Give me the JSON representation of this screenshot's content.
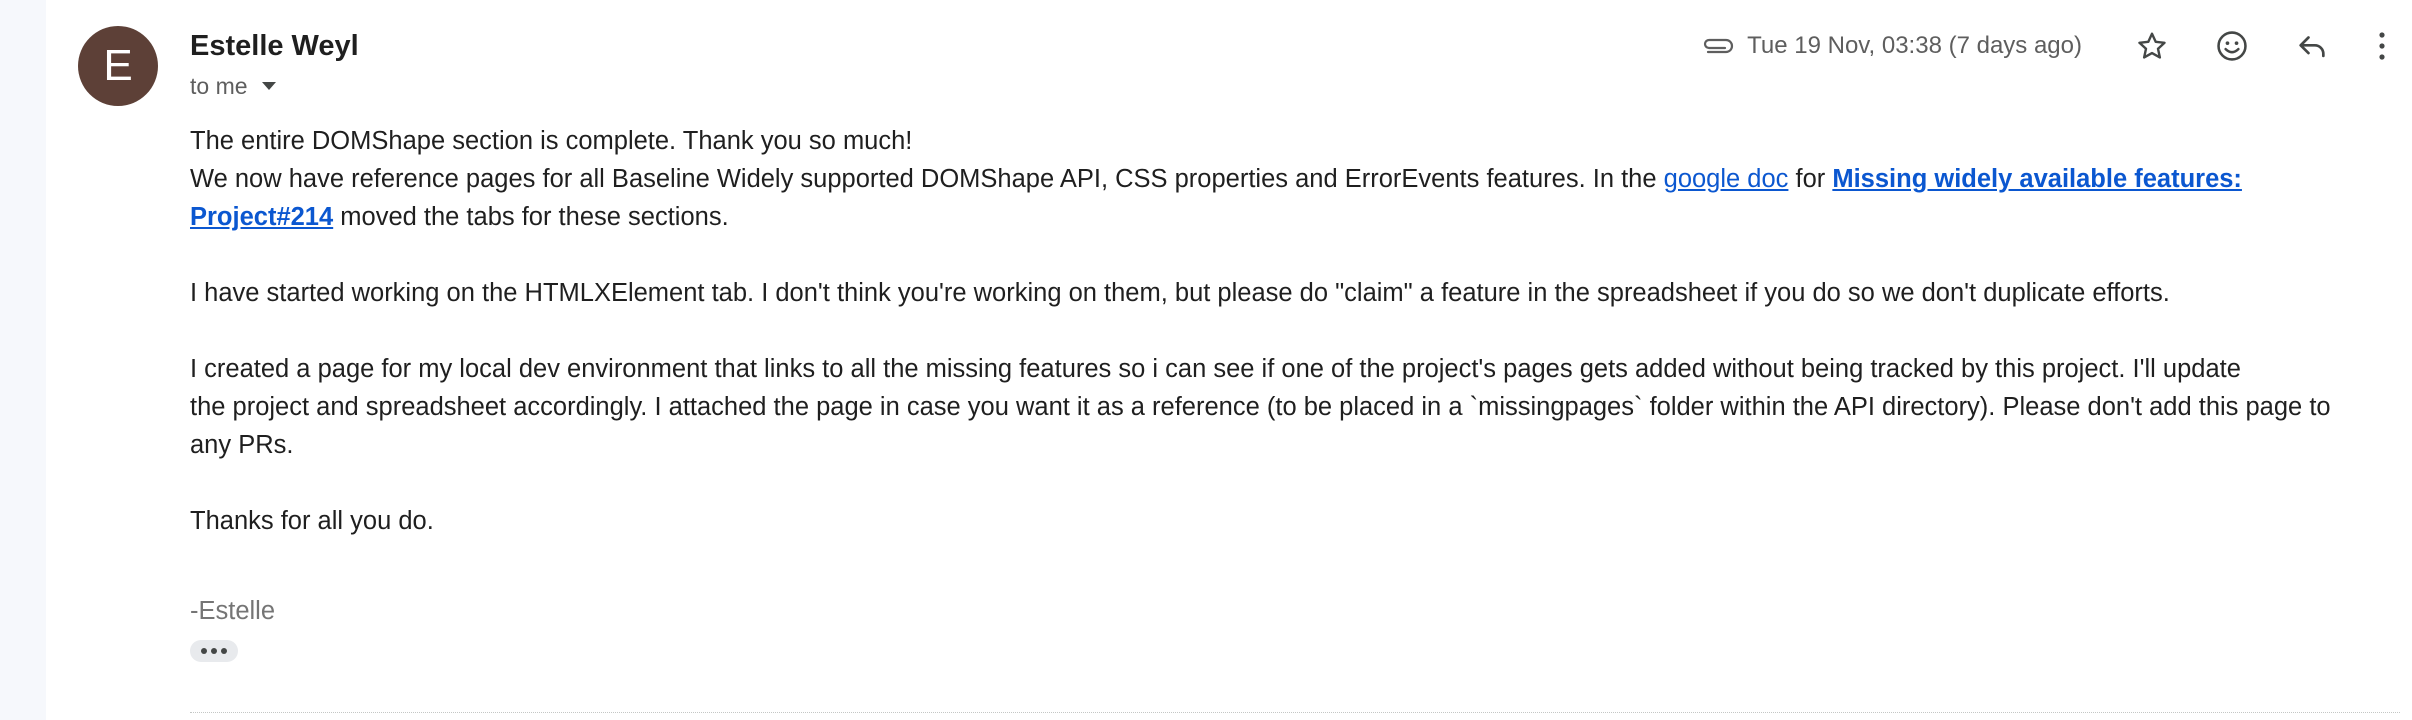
{
  "sender": {
    "avatar_letter": "E",
    "avatar_color": "#5d4037",
    "name": "Estelle Weyl"
  },
  "recipient": {
    "label": "to me"
  },
  "meta": {
    "attachment_icon": "paperclip-icon",
    "timestamp": "Tue 19 Nov, 03:38 (7 days ago)",
    "actions": [
      "star-icon",
      "emoji-icon",
      "reply-icon",
      "more-vert-icon"
    ]
  },
  "body": {
    "line1": "The entire DOMShape section is complete. Thank you so much!",
    "para2_before_link": "We now have reference pages for all Baseline Widely supported DOMShape API, CSS properties and ErrorEvents features. In the ",
    "para2_link1": "google doc",
    "para2_mid": " for ",
    "para2_link2_line1": "Missing widely available features:",
    "para2_link2_line2": "Project#214",
    "para2_after": " moved the tabs for these sections.",
    "para3": "I have started working on the HTMLXElement tab. I don't think you're working on them, but please do \"claim\" a feature in the spreadsheet if you do so we don't duplicate efforts.",
    "para4_line1": "I created a page for my local dev environment that links to all the missing features so i can see if one of the project's pages gets added without being tracked by this project. I'll update",
    "para4_line2": "the project and spreadsheet accordingly. I attached the page in case you want it as a reference (to be placed in a `missingpages` folder within the API directory). Please don't add this page to",
    "para4_line3": "any PRs.",
    "para5": "Thanks for all you do.",
    "signature": "-Estelle"
  },
  "colors": {
    "link": "#0b57d0",
    "text": "#1f1f1f",
    "muted": "#5e5e5e"
  }
}
